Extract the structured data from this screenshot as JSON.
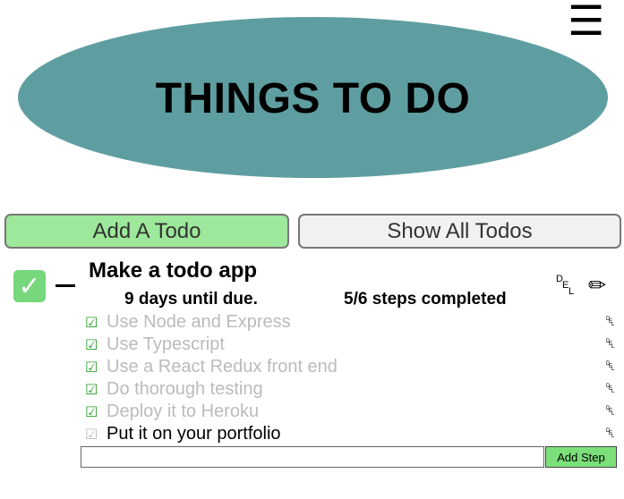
{
  "header": {
    "menu_icon": "hamburger-menu-icon",
    "menu_glyph": "☰",
    "title": "THINGS TO DO",
    "banner_color": "#5f9ea0"
  },
  "tabs": {
    "add_label": "Add A Todo",
    "add_color": "#9de89a",
    "show_all_label": "Show All Todos"
  },
  "todo": {
    "done_glyph": "✓",
    "done_color": "#77d77c",
    "title": "Make a todo app",
    "due_text": "9 days until due.",
    "steps_completed": "5/6 steps completed",
    "delete_letters": [
      "D",
      "E",
      "L"
    ],
    "edit_glyph": "✏",
    "steps": [
      {
        "text": "Use Node and Express",
        "completed": true
      },
      {
        "text": "Use Typescript",
        "completed": true
      },
      {
        "text": "Use a React Redux front end",
        "completed": true
      },
      {
        "text": "Do thorough testing",
        "completed": true
      },
      {
        "text": "Deploy it to Heroku",
        "completed": true
      },
      {
        "text": "Put it on your portfolio",
        "completed": false
      }
    ],
    "step_check_glyph": "☑",
    "step_check_color_done": "#2e9c2e",
    "step_check_color_pending": "#bbbbbb",
    "step_text_color_done": "#bbbbbb",
    "step_text_color_pending": "#000000",
    "new_step_value": "",
    "new_step_placeholder": "",
    "add_step_label": "Add Step",
    "add_step_color": "#7ce07a"
  }
}
